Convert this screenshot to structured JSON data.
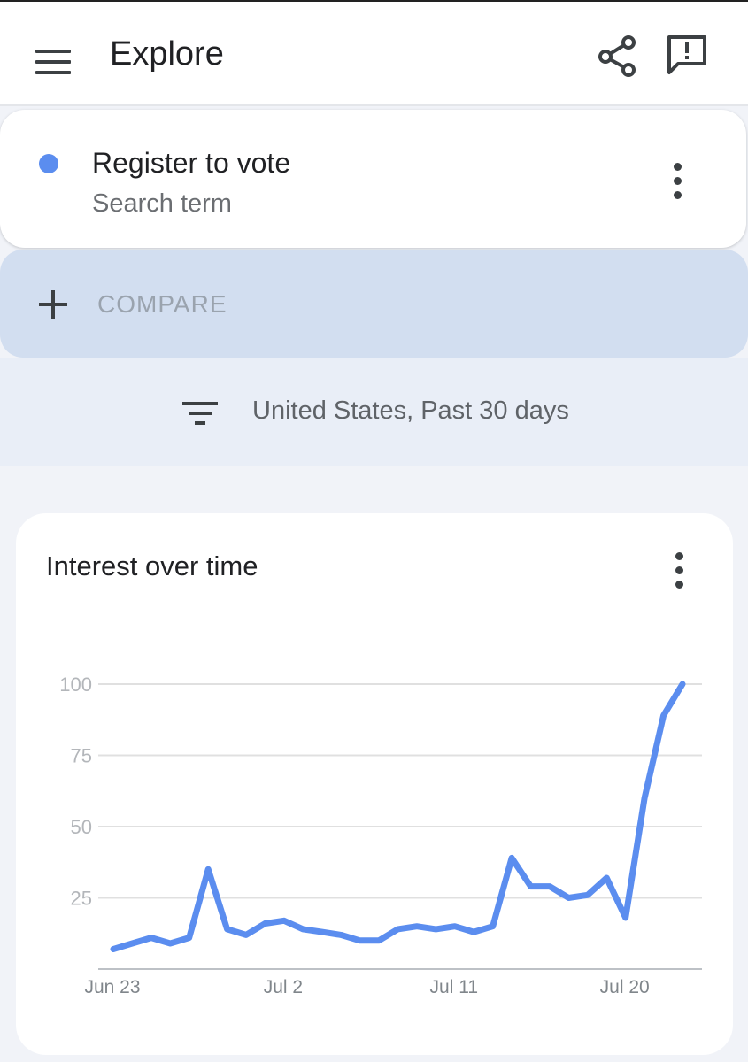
{
  "header": {
    "title": "Explore",
    "menu_icon": "hamburger-menu-icon",
    "share_icon": "share-icon",
    "feedback_icon": "feedback-icon"
  },
  "search_term": {
    "name": "Register to vote",
    "type": "Search term",
    "color": "#5b8def"
  },
  "compare": {
    "label": "COMPARE",
    "icon": "plus-icon"
  },
  "filter": {
    "icon": "filter-icon",
    "text": "United States, Past 30 days"
  },
  "chart_data": {
    "type": "line",
    "title": "Interest over time",
    "xlabel": "",
    "ylabel": "",
    "ylim": [
      0,
      100
    ],
    "yticks": [
      25,
      50,
      75,
      100
    ],
    "x_tick_labels": [
      {
        "index": 0,
        "label": "Jun 23"
      },
      {
        "index": 9,
        "label": "Jul 2"
      },
      {
        "index": 18,
        "label": "Jul 11"
      },
      {
        "index": 27,
        "label": "Jul 20"
      }
    ],
    "grid": true,
    "series": [
      {
        "color": "#5b8def",
        "values": [
          7,
          9,
          11,
          9,
          11,
          35,
          14,
          12,
          16,
          17,
          14,
          13,
          12,
          10,
          10,
          14,
          15,
          14,
          15,
          13,
          15,
          39,
          29,
          29,
          25,
          26,
          32,
          18,
          60,
          89,
          100
        ]
      }
    ]
  }
}
